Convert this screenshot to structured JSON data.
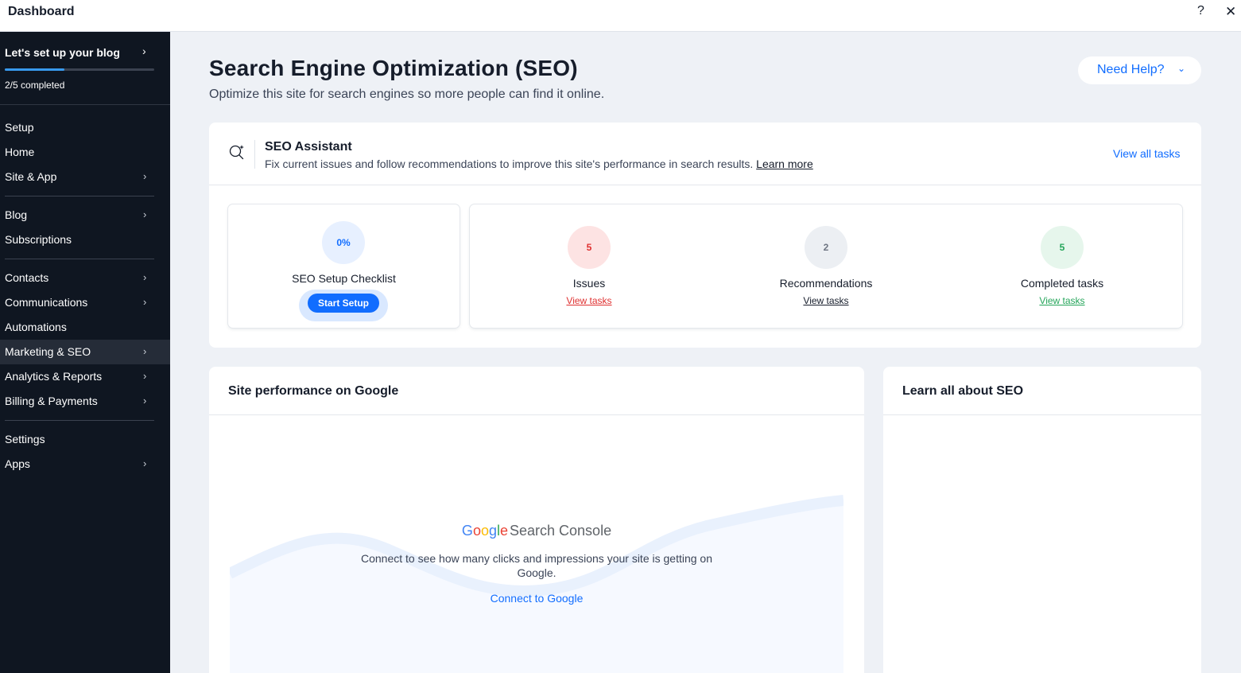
{
  "window": {
    "title": "Dashboard",
    "help_glyph": "?",
    "close_glyph": "✕"
  },
  "sidebar": {
    "setup": {
      "title": "Let's set up your blog",
      "progress_text": "2/5 completed",
      "progress_fraction": 0.4
    },
    "items": [
      {
        "label": "Setup",
        "chevron": false
      },
      {
        "label": "Home",
        "chevron": false
      },
      {
        "label": "Site & App",
        "chevron": true
      },
      {
        "label": "Blog",
        "chevron": true
      },
      {
        "label": "Subscriptions",
        "chevron": false
      },
      {
        "label": "Contacts",
        "chevron": true
      },
      {
        "label": "Communications",
        "chevron": true
      },
      {
        "label": "Automations",
        "chevron": false
      },
      {
        "label": "Marketing & SEO",
        "chevron": true,
        "active": true
      },
      {
        "label": "Analytics & Reports",
        "chevron": true
      },
      {
        "label": "Billing & Payments",
        "chevron": true
      },
      {
        "label": "Settings",
        "chevron": false
      },
      {
        "label": "Apps",
        "chevron": true
      }
    ]
  },
  "header": {
    "title": "Search Engine Optimization (SEO)",
    "subtitle": "Optimize this site for search engines so more people can find it online.",
    "help_button": "Need Help?"
  },
  "seo_assistant": {
    "title": "SEO Assistant",
    "description": "Fix current issues and follow recommendations to improve this site's performance in search results.",
    "learn_more": "Learn more",
    "view_all": "View all tasks",
    "checklist": {
      "percent": "0%",
      "label": "SEO Setup Checklist",
      "button": "Start Setup"
    },
    "stats": [
      {
        "value": "5",
        "label": "Issues",
        "link": "View tasks",
        "color": "#df3131"
      },
      {
        "value": "2",
        "label": "Recommendations",
        "link": "View tasks",
        "color": "#161d2b"
      },
      {
        "value": "5",
        "label": "Completed tasks",
        "link": "View tasks",
        "color": "#25a55a"
      }
    ]
  },
  "performance": {
    "title": "Site performance on Google",
    "logo_google": "Google",
    "logo_rest": "Search Console",
    "description": "Connect to see how many clicks and impressions your site is getting on Google.",
    "connect": "Connect to Google"
  },
  "learn": {
    "title": "Learn all about SEO"
  },
  "colors": {
    "accent": "#116dff",
    "sidebar_bg": "#0f1621",
    "main_bg": "#eef1f6"
  }
}
